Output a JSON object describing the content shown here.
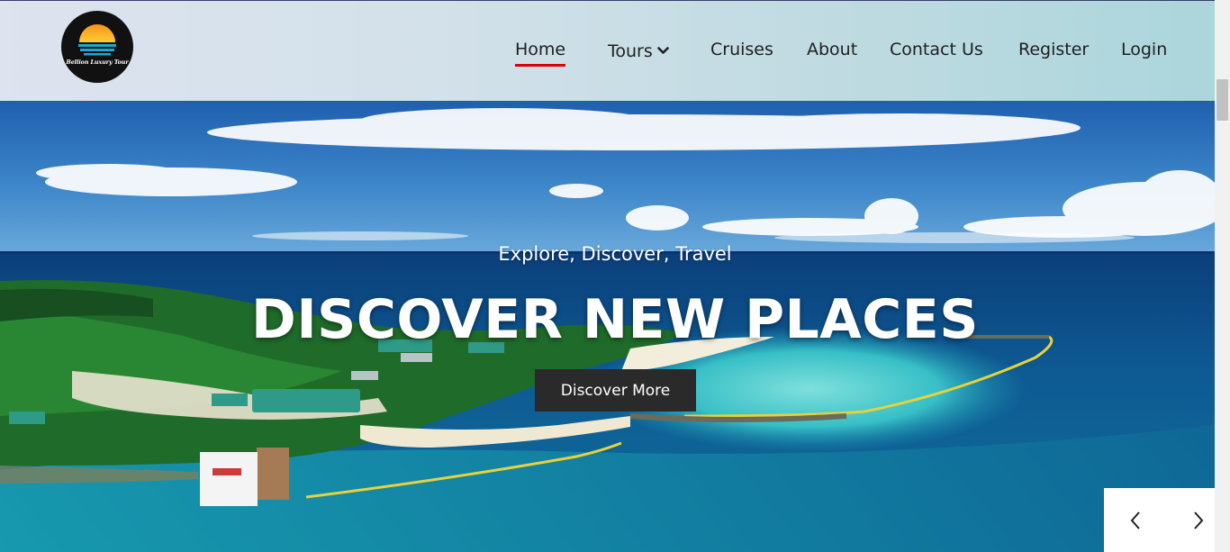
{
  "brand": {
    "logo_text": "Bellion Luxury Tour",
    "logo_icon": "sunset-over-water-icon",
    "colors": {
      "sun_top": "#f7931e",
      "sun_bottom": "#ffcc33",
      "water": "#1ca9d6",
      "logo_bg": "#111111"
    }
  },
  "nav": {
    "items": [
      {
        "label": "Home",
        "active": true
      },
      {
        "label": "Tours",
        "has_dropdown": true,
        "icon": "chevron-down-icon"
      },
      {
        "label": "Cruises"
      },
      {
        "label": "About"
      },
      {
        "label": "Contact Us"
      },
      {
        "label": "Register"
      },
      {
        "label": "Login"
      }
    ],
    "active_underline_color": "#e00000"
  },
  "hero": {
    "subtitle": "Explore, Discover, Travel",
    "title": "DISCOVER NEW PLACES",
    "cta_label": "Discover More",
    "background": "aerial-tropical-island-photo",
    "slider": {
      "prev_icon": "chevron-left-icon",
      "next_icon": "chevron-right-icon"
    }
  }
}
